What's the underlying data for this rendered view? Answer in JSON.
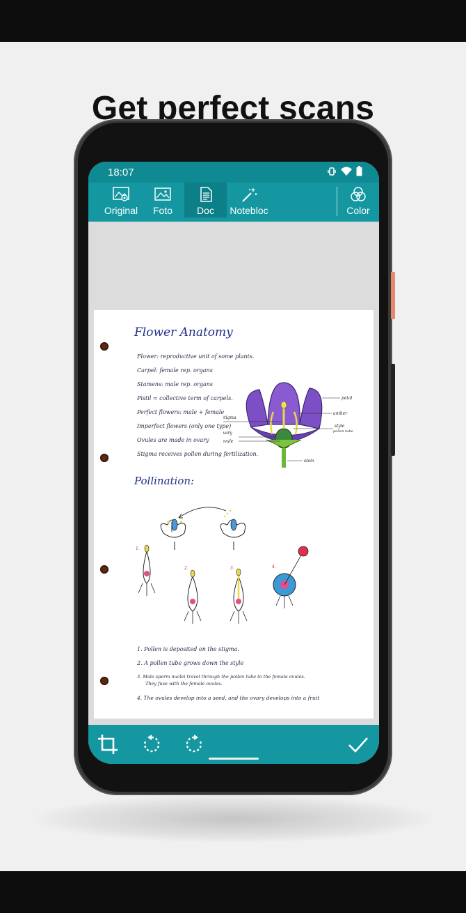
{
  "headline": "Get perfect scans",
  "status": {
    "time": "18:07"
  },
  "toolbar": {
    "modes": [
      {
        "label": "Original",
        "icon": "original-image-icon"
      },
      {
        "label": "Foto",
        "icon": "photo-icon"
      },
      {
        "label": "Doc",
        "icon": "document-icon"
      },
      {
        "label": "Notebloc",
        "icon": "magic-wand-icon"
      }
    ],
    "active_mode": "Doc",
    "color_label": "Color",
    "color_icon": "color-filter-icon"
  },
  "document": {
    "title": "Flower Anatomy",
    "bullets": [
      "Flower: reproductive unit of some plants.",
      "Carpel: female rep. organs",
      "Stamens: male rep. organs",
      "Pistil = collective term of carpels.",
      "Perfect flowers: male + female",
      "Imperfect flowers (only one type)",
      "Ovules are made in ovary",
      "Stigma receives pollen during fertilization."
    ],
    "diagram_labels": {
      "petal": "petal",
      "anther": "anther",
      "stigma": "stigma",
      "style": "style",
      "pollen_tube": "pollen tube",
      "ovary": "ovary",
      "ovule": "ovule",
      "stem": "stem"
    },
    "section_title": "Pollination:",
    "step_numbers": [
      "1.",
      "2.",
      "3.",
      "4."
    ],
    "steps": [
      "1. Pollen is deposited on the stigma.",
      "2. A pollen tube grows down the style",
      "3. Male sperm nuclei travel through the pollen tube to the female ovules.",
      "They fuse with the female ovules.",
      "4. The ovules develop into a seed, and the ovary develops into a fruit"
    ]
  },
  "bottom_toolbar": {
    "icons": [
      "crop-icon",
      "rotate-left-icon",
      "rotate-right-icon",
      "confirm-check-icon"
    ]
  },
  "colors": {
    "teal": "#1597a2",
    "teal_dark": "#0d7f88",
    "ink_blue": "#1f2e86",
    "petal_purple": "#7d4fc4"
  }
}
